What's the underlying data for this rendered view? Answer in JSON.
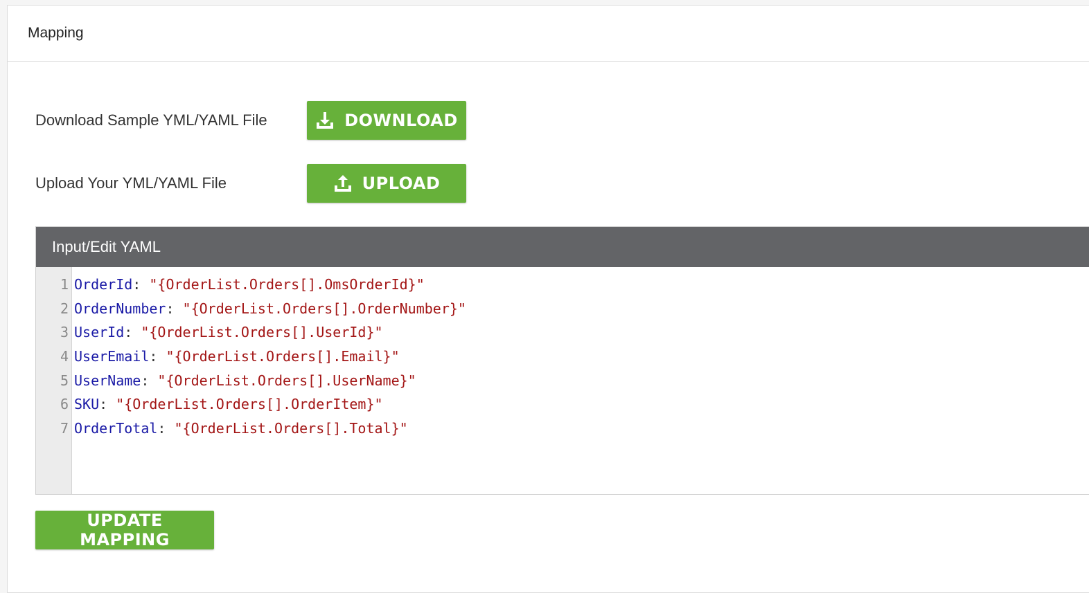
{
  "panel": {
    "title": "Mapping"
  },
  "download_row": {
    "label": "Download Sample YML/YAML File",
    "button_label": "DOWNLOAD",
    "icon": "download-icon"
  },
  "upload_row": {
    "label": "Upload Your YML/YAML File",
    "button_label": "UPLOAD",
    "icon": "upload-icon"
  },
  "editor": {
    "title": "Input/Edit YAML",
    "lines": [
      {
        "num": "1",
        "key": "OrderId",
        "value": "\"{OrderList.Orders[].OmsOrderId}\""
      },
      {
        "num": "2",
        "key": "OrderNumber",
        "value": "\"{OrderList.Orders[].OrderNumber}\""
      },
      {
        "num": "3",
        "key": "UserId",
        "value": "\"{OrderList.Orders[].UserId}\""
      },
      {
        "num": "4",
        "key": "UserEmail",
        "value": "\"{OrderList.Orders[].Email}\""
      },
      {
        "num": "5",
        "key": "UserName",
        "value": "\"{OrderList.Orders[].UserName}\""
      },
      {
        "num": "6",
        "key": "SKU",
        "value": "\"{OrderList.Orders[].OrderItem}\""
      },
      {
        "num": "7",
        "key": "OrderTotal",
        "value": "\"{OrderList.Orders[].Total}\""
      }
    ]
  },
  "update_button": {
    "label": "UPDATE MAPPING"
  },
  "colors": {
    "button_green": "#67b13a",
    "editor_header": "#636467",
    "yaml_key": "#1a1aa6",
    "yaml_string": "#a31515"
  }
}
